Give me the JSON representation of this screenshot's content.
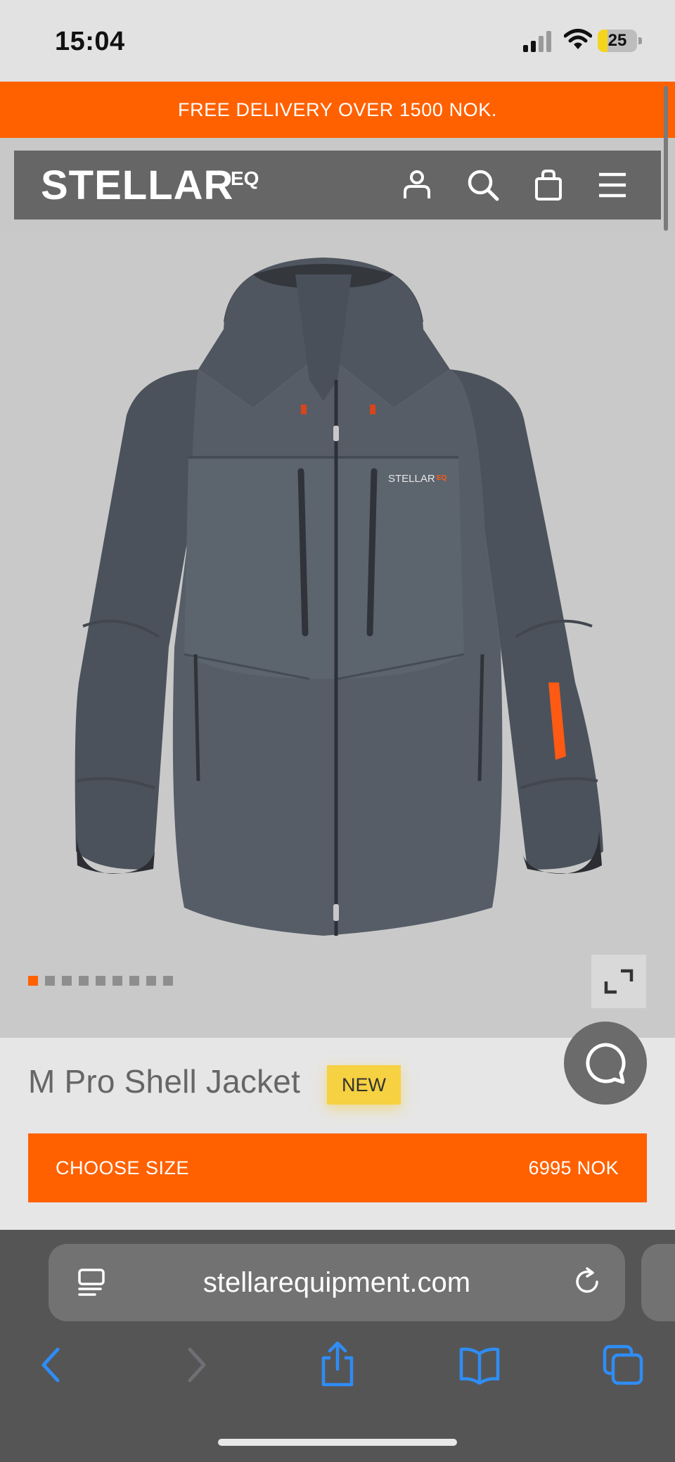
{
  "status_bar": {
    "time": "15:04",
    "battery": "25",
    "battery_level": 0.25
  },
  "promo": {
    "text": "FREE DELIVERY OVER 1500 NOK."
  },
  "header": {
    "logo": "STELLAR",
    "logo_sup": "EQ",
    "icons": [
      "user-icon",
      "search-icon",
      "shopping-bag-icon",
      "menu-icon"
    ]
  },
  "gallery": {
    "image_name": "jacket-product-image",
    "jacket_logo": "STELLAR",
    "jacket_logo_sup": "EQ",
    "slide_count": 9,
    "active_slide": 1
  },
  "product": {
    "title": "M Pro Shell Jacket",
    "badge": "NEW",
    "cta_label": "CHOOSE SIZE",
    "price": "6995 NOK"
  },
  "browser": {
    "url": "stellarequipment.com",
    "toolbar_icons": [
      "back-icon",
      "forward-icon",
      "share-icon",
      "bookmarks-icon",
      "tabs-icon"
    ]
  },
  "colors": {
    "accent": "#ff6100",
    "header_bg": "#666666",
    "badge": "#f6d141",
    "browser_blue": "#2f8df5"
  }
}
